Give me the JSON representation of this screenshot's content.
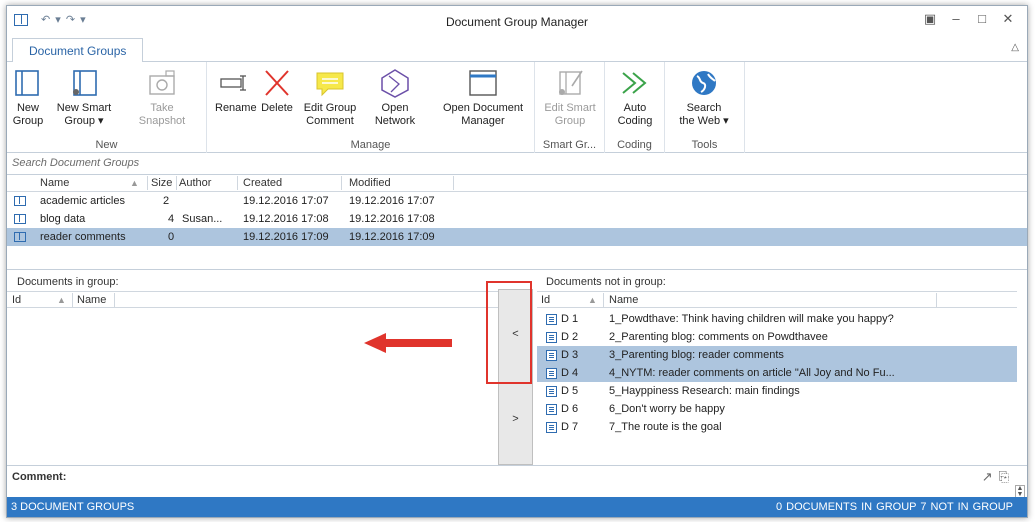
{
  "window": {
    "title": "Document Group Manager",
    "qat": "↶ ▾  ↷ ▾",
    "controls": [
      "▣",
      "–",
      "□",
      "✕"
    ]
  },
  "ribbon": {
    "tab": "Document Groups",
    "groups": [
      {
        "label": "New",
        "buttons": [
          {
            "line1": "New",
            "line2": "Group",
            "icon": "folder-icon"
          },
          {
            "line1": "New Smart",
            "line2": "Group ▾",
            "icon": "smart-group-icon"
          },
          {
            "line1": "Take",
            "line2": "Snapshot",
            "icon": "camera-icon",
            "disabled": true
          }
        ]
      },
      {
        "label": "Manage",
        "buttons": [
          {
            "line1": "Rename",
            "line2": "",
            "icon": "rename-icon"
          },
          {
            "line1": "Delete",
            "line2": "",
            "icon": "delete-icon"
          },
          {
            "line1": "Edit Group",
            "line2": "Comment",
            "icon": "comment-icon"
          },
          {
            "line1": "Open",
            "line2": "Network",
            "icon": "network-icon"
          },
          {
            "line1": "Open Document",
            "line2": "Manager",
            "icon": "window-icon"
          }
        ]
      },
      {
        "label": "Smart Gr...",
        "buttons": [
          {
            "line1": "Edit Smart",
            "line2": "Group",
            "icon": "edit-smart-group-icon",
            "disabled": true
          }
        ]
      },
      {
        "label": "Coding",
        "buttons": [
          {
            "line1": "Auto",
            "line2": "Coding",
            "icon": "auto-coding-icon"
          }
        ]
      },
      {
        "label": "Tools",
        "buttons": [
          {
            "line1": "Search",
            "line2": "the Web ▾",
            "icon": "globe-icon"
          }
        ]
      }
    ]
  },
  "search": {
    "placeholder": "Search Document Groups"
  },
  "groups_table": {
    "columns": [
      "Name",
      "Size",
      "Author",
      "Created",
      "Modified"
    ],
    "sort_indicator": "▲",
    "rows": [
      {
        "name": "academic articles",
        "size": "2",
        "author": "",
        "created": "19.12.2016 17:07",
        "modified": "19.12.2016 17:07"
      },
      {
        "name": "blog data",
        "size": "4",
        "author": "Susan...",
        "created": "19.12.2016 17:08",
        "modified": "19.12.2016 17:08"
      },
      {
        "name": "reader comments",
        "size": "0",
        "author": "",
        "created": "19.12.2016 17:09",
        "modified": "19.12.2016 17:09",
        "selected": true
      }
    ]
  },
  "in_group": {
    "title": "Documents in group:",
    "columns": [
      "Id",
      "Name"
    ]
  },
  "not_in_group": {
    "title": "Documents not in group:",
    "columns": [
      "Id",
      "Name"
    ],
    "rows": [
      {
        "id": "D 1",
        "name": "1_Powdthave: Think having children will make you happy?",
        "icon": "image-doc-icon"
      },
      {
        "id": "D 2",
        "name": "2_Parenting blog: comments on Powdthavee",
        "icon": "text-doc-icon"
      },
      {
        "id": "D 3",
        "name": "3_Parenting blog: reader comments",
        "icon": "text-doc-icon",
        "selected": true
      },
      {
        "id": "D 4",
        "name": "4_NYTM: reader comments on article \"All Joy and No Fu...",
        "icon": "text-doc-icon",
        "selected": true
      },
      {
        "id": "D 5",
        "name": "5_Hayppiness Research: main findings",
        "icon": "text-doc-icon"
      },
      {
        "id": "D 6",
        "name": "6_Don't worry be happy",
        "icon": "image-doc-icon"
      },
      {
        "id": "D 7",
        "name": "7_The route is the goal",
        "icon": "image-doc-icon"
      }
    ]
  },
  "transfer": {
    "add": "<",
    "remove": ">"
  },
  "comment": {
    "label": "Comment:"
  },
  "status": {
    "left": "3 DOCUMENT GROUPS",
    "right": "0 DOCUMENTS IN GROUP   7 NOT IN GROUP"
  },
  "colors": {
    "accent": "#2f78c4",
    "selection": "#adc5de",
    "annotation_red": "#e0342c"
  }
}
